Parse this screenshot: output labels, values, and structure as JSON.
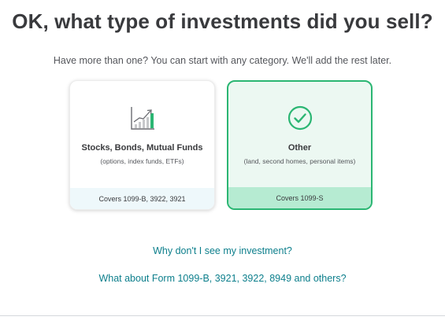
{
  "headline": "OK, what type of investments did you sell?",
  "subhead": "Have more than one? You can start with any category. We'll add the rest later.",
  "cards": [
    {
      "title": "Stocks, Bonds, Mutual Funds",
      "subtitle": "(options, index funds, ETFs)",
      "footer": "Covers 1099-B, 3922, 3921",
      "icon": "chart-growth-icon",
      "selected": false
    },
    {
      "title": "Other",
      "subtitle": "(land, second homes, personal items)",
      "footer": "Covers 1099-S",
      "icon": "check-circle-icon",
      "selected": true
    }
  ],
  "links": {
    "why": "Why don't I see my investment?",
    "forms": "What about Form 1099-B, 3921, 3922, 8949 and others?"
  },
  "colors": {
    "accent": "#2bb673",
    "link": "#0d7f8c",
    "selected_bg": "#ecf8f2",
    "selected_footer": "#b6ebd2",
    "card_footer": "#eef8fb"
  }
}
